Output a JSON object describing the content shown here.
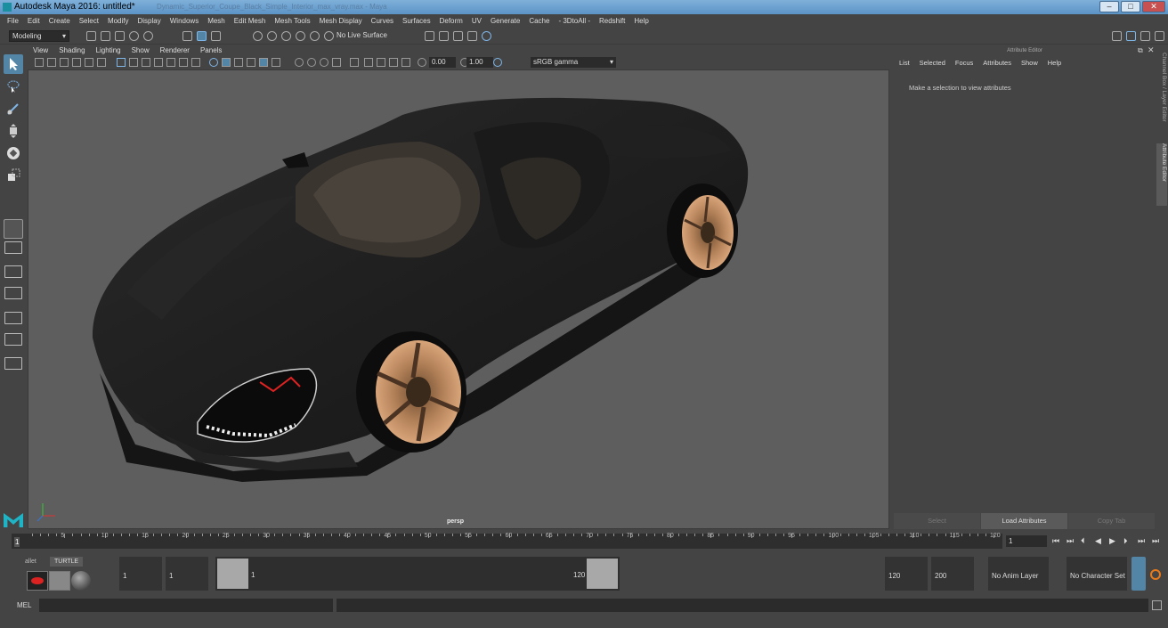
{
  "window": {
    "title": "Autodesk Maya 2016: untitled*",
    "ghost_title": "Dynamic_Superior_Coupe_Black_Simple_Interior_max_vray.max - Maya"
  },
  "menubar": [
    "File",
    "Edit",
    "Create",
    "Select",
    "Modify",
    "Display",
    "Windows",
    "Mesh",
    "Edit Mesh",
    "Mesh Tools",
    "Mesh Display",
    "Curves",
    "Surfaces",
    "Deform",
    "UV",
    "Generate",
    "Cache",
    "- 3DtoAll -",
    "Redshift",
    "Help"
  ],
  "shelf": {
    "mode": "Modeling",
    "live_surface": "No Live Surface"
  },
  "panel_menus": [
    "View",
    "Shading",
    "Lighting",
    "Show",
    "Renderer",
    "Panels"
  ],
  "viewport_toolbar": {
    "exposure": "0.00",
    "gamma_value": "1.00",
    "color_space": "sRGB gamma"
  },
  "viewport": {
    "camera_label": "persp"
  },
  "attribute_editor": {
    "title": "Attribute Editor",
    "menus": [
      "List",
      "Selected",
      "Focus",
      "Attributes",
      "Show",
      "Help"
    ],
    "message": "Make a selection to view attributes",
    "buttons": {
      "select": "Select",
      "load": "Load Attributes",
      "copy": "Copy Tab"
    }
  },
  "side_tabs": {
    "channel_box": "Channel Box / Layer Editor",
    "attribute_editor": "Attribute Editor"
  },
  "timeline": {
    "ticks": [
      "5",
      "10",
      "15",
      "20",
      "25",
      "30",
      "35",
      "40",
      "45",
      "50",
      "55",
      "60",
      "65",
      "70",
      "75",
      "80",
      "85",
      "90",
      "95",
      "100",
      "105",
      "110",
      "115",
      "120"
    ],
    "start_marker": "1",
    "current_frame": "1"
  },
  "range": {
    "start": "1",
    "anim_start": "1",
    "slider_start": "1",
    "slider_end": "120",
    "anim_end": "120",
    "end": "200",
    "anim_layer": "No Anim Layer",
    "character_set": "No Character Set"
  },
  "shelf_tabs": {
    "tab1": "allet",
    "tab2": "TURTLE"
  },
  "command_line": {
    "label": "MEL"
  },
  "colors": {
    "accent": "#5285a6",
    "body_paint": "#1c1c1c",
    "rim": "#b5835a",
    "viewport_bg": "#5e5e5e"
  }
}
